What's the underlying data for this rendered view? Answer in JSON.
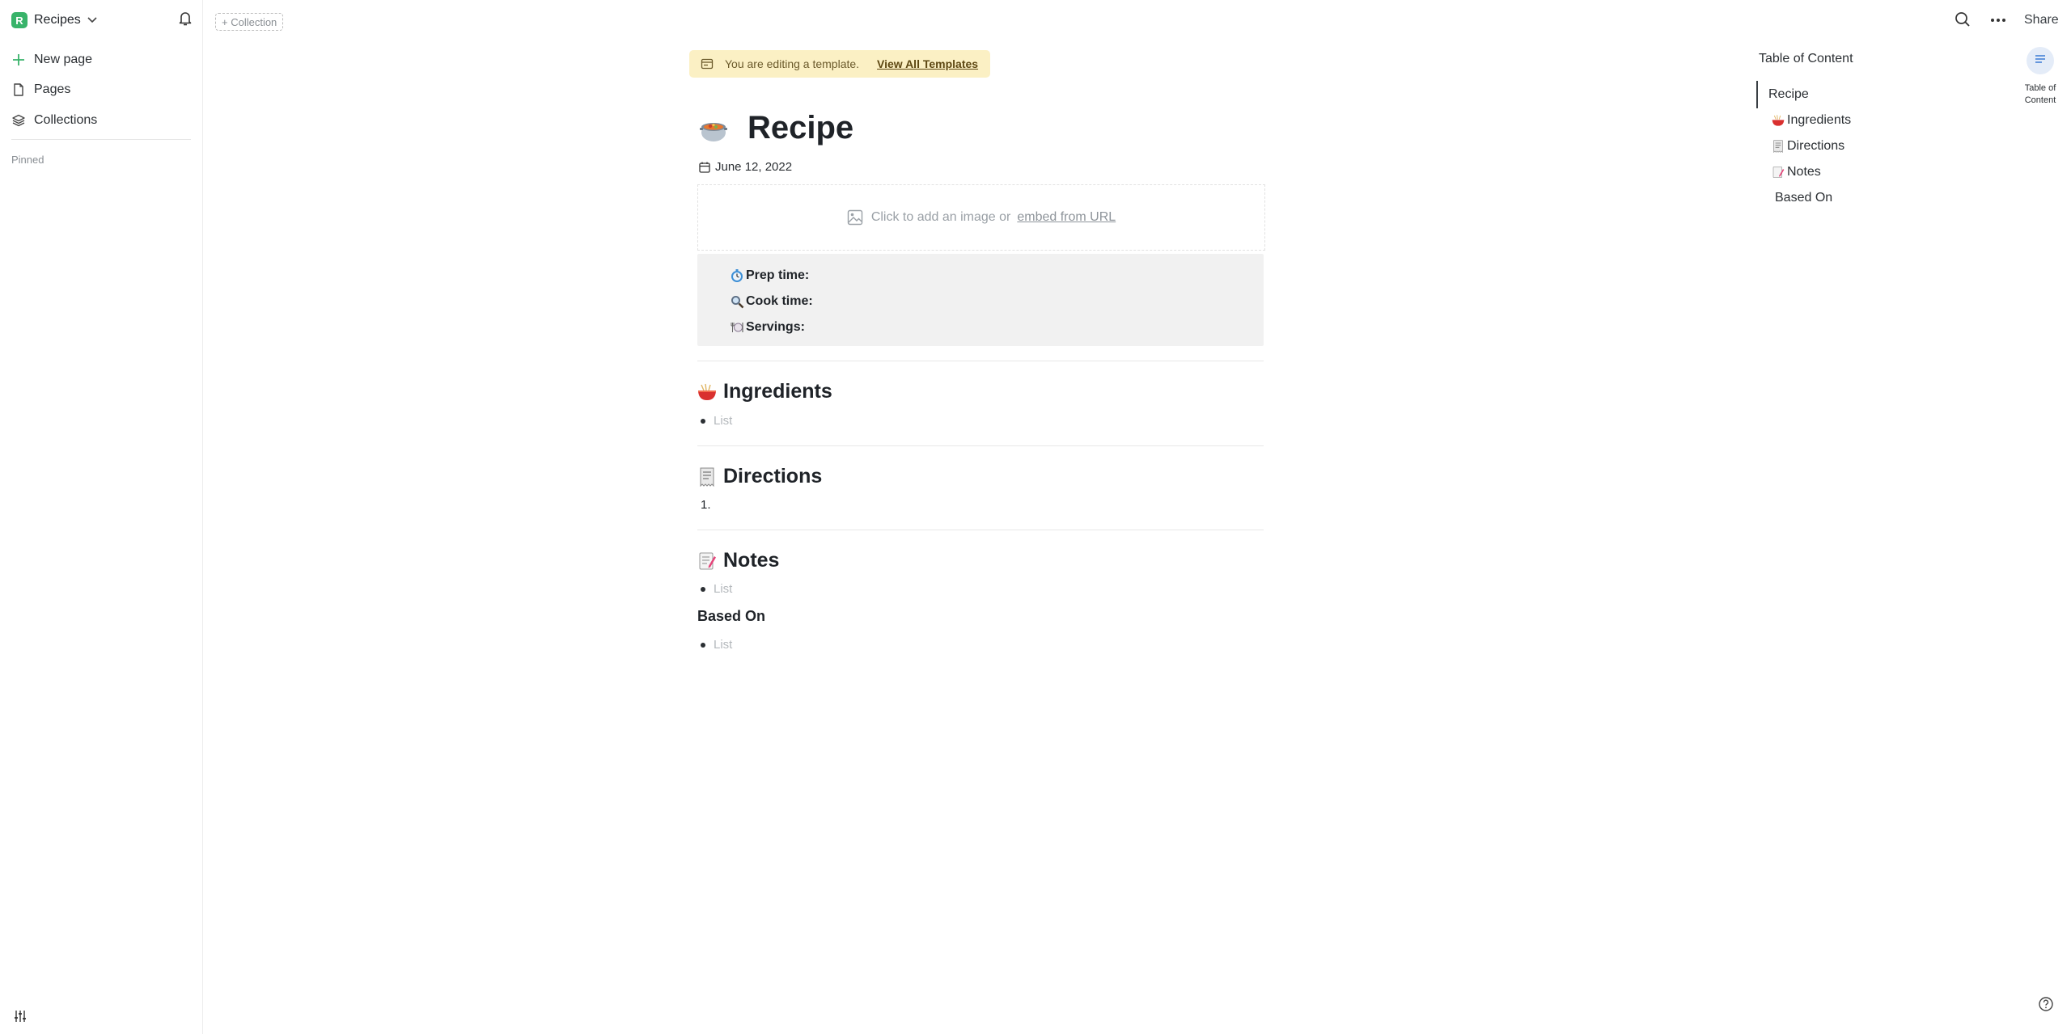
{
  "sidebar": {
    "workspace_initial": "R",
    "workspace_name": "Recipes",
    "items": [
      {
        "label": "New page",
        "icon": "plus-icon"
      },
      {
        "label": "Pages",
        "icon": "page-icon"
      },
      {
        "label": "Collections",
        "icon": "layers-icon"
      }
    ],
    "pinned_label": "Pinned"
  },
  "topbar": {
    "collection_button": "+ Collection",
    "share_label": "Share"
  },
  "banner": {
    "text": "You are editing a template.",
    "link": "View All Templates"
  },
  "page": {
    "title": "Recipe",
    "date": "June 12, 2022",
    "image_prompt": "Click to add an image or",
    "image_link": "embed from URL",
    "info": [
      {
        "label": "Prep time:",
        "icon": "timer-icon"
      },
      {
        "label": "Cook time:",
        "icon": "magnifier-icon"
      },
      {
        "label": "Servings:",
        "icon": "plate-icon"
      }
    ],
    "sections": {
      "ingredients": {
        "heading": "Ingredients",
        "placeholder": "List"
      },
      "directions": {
        "heading": "Directions",
        "item": "1."
      },
      "notes": {
        "heading": "Notes",
        "placeholder": "List"
      },
      "based_on": {
        "heading": "Based On",
        "placeholder": "List"
      }
    }
  },
  "toc": {
    "title": "Table of Content",
    "items": [
      "Recipe",
      "Ingredients",
      "Directions",
      "Notes",
      "Based On"
    ],
    "button_label_line1": "Table of",
    "button_label_line2": "Content"
  },
  "colors": {
    "accent_green": "#38b36a",
    "banner_bg": "#fbf0c4",
    "toc_button_bg": "#e4ecf8"
  }
}
